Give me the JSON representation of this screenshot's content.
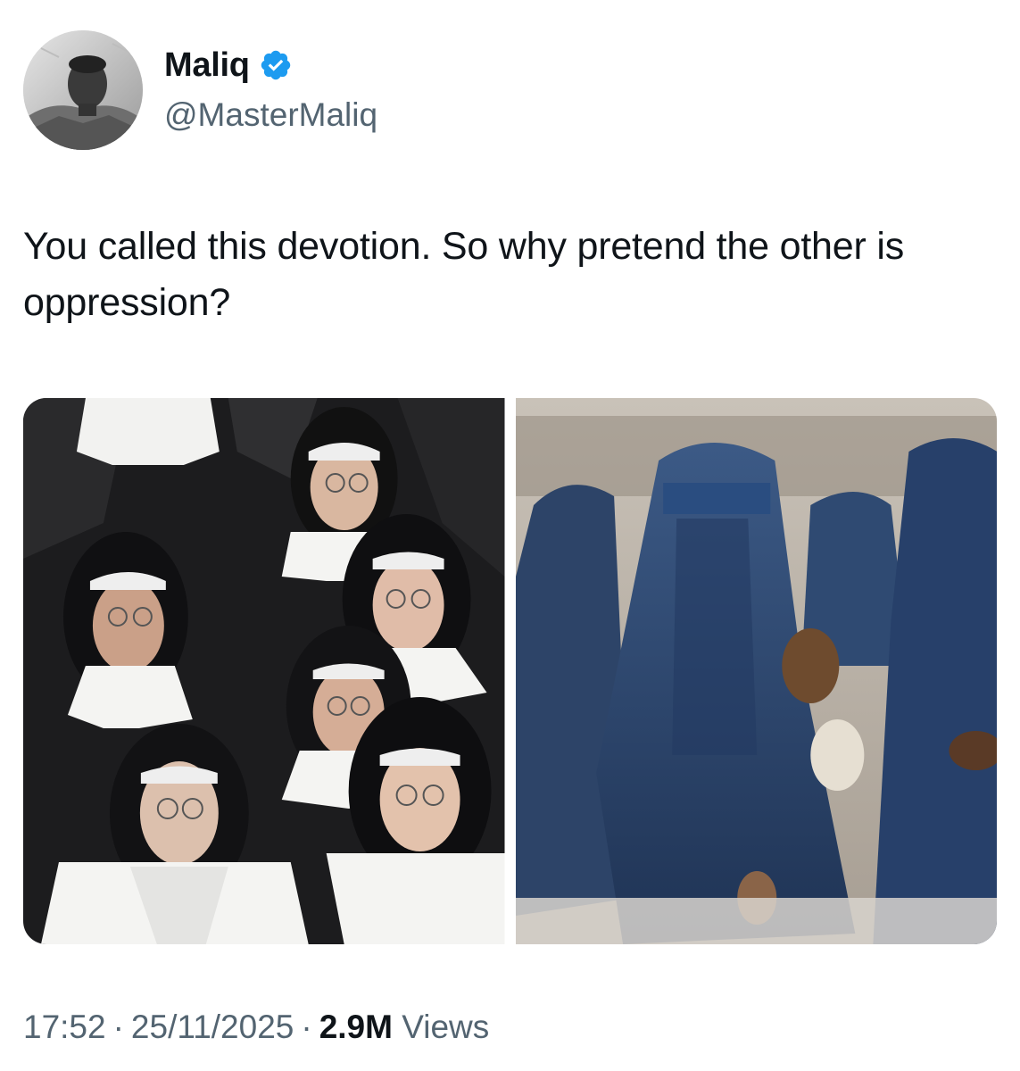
{
  "author": {
    "display_name": "Maliq",
    "handle": "@MasterMaliq",
    "verified": true,
    "verified_color": "#1d9bf0"
  },
  "tweet": {
    "text": "You called this devotion. So why pretend the other is oppression?"
  },
  "media": [
    {
      "kind": "photo"
    },
    {
      "kind": "photo"
    }
  ],
  "meta": {
    "time": "17:52",
    "separator": "·",
    "date": "25/11/2025",
    "views_count": "2.9M",
    "views_label": "Views"
  },
  "colors": {
    "text_primary": "#0f1419",
    "text_secondary": "#536471",
    "background": "#ffffff"
  }
}
